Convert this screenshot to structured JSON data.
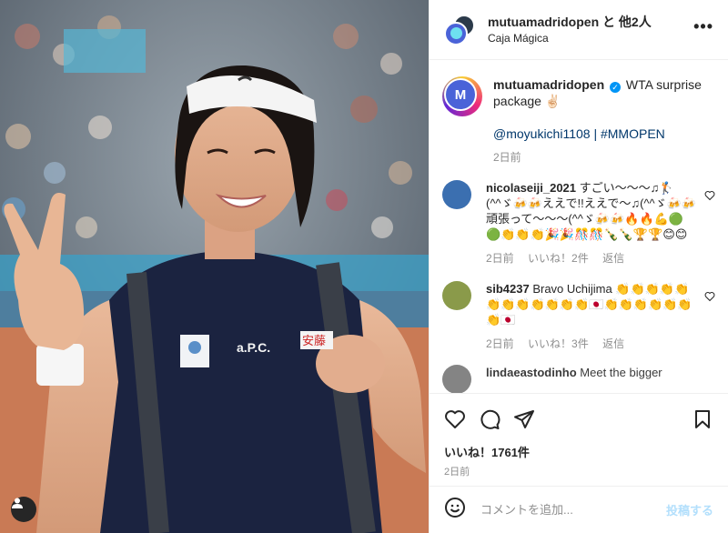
{
  "header": {
    "username": "mutuamadridopen",
    "others": "と 他2人",
    "location": "Caja Mágica",
    "more_icon": "more-horizontal-icon"
  },
  "caption": {
    "username": "mutuamadridopen",
    "text": "WTA surprise package ✌🏻",
    "tags": "@moyukichi1108 | #MMOPEN",
    "time": "2日前",
    "avatar_letter": "M"
  },
  "comments": [
    {
      "username": "nicolaseiji_2021",
      "text": "すごい〜〜〜♫🏌(^^ゞ🍻🍻ええで!!ええで〜♫(^^ゞ🍻🍻頑張って〜〜〜(^^ゞ🍻🍻🔥🔥💪🟢🟢👏👏👏🎉🎉🎊🎊🍾🍾🏆🏆😊😊",
      "time": "2日前",
      "likes": "いいね！2件",
      "reply": "返信",
      "avatar_color": "#3b6fb0"
    },
    {
      "username": "sib4237",
      "text": "Bravo Uchijima 👏👏👏👏👏👏👏👏👏👏👏👏🇯🇵👏👏👏👏👏👏👏🇯🇵",
      "time": "2日前",
      "likes": "いいね！3件",
      "reply": "返信",
      "avatar_color": "#8a9a4a"
    },
    {
      "username": "lindaeastodinho",
      "text": "Meet the bigger",
      "avatar_color": "#777777"
    }
  ],
  "actions": {
    "likes": "いいね！1761件",
    "time": "2日前"
  },
  "add_comment": {
    "placeholder": "コメントを追加...",
    "post": "投稿する"
  },
  "photo": {
    "shirt_text": "a.P.C.",
    "flag_text": "安藤"
  },
  "colors": {
    "link": "#00376b",
    "verified": "#0095f6",
    "post_disabled": "#b2dffc",
    "meta": "#8e8e8e"
  }
}
